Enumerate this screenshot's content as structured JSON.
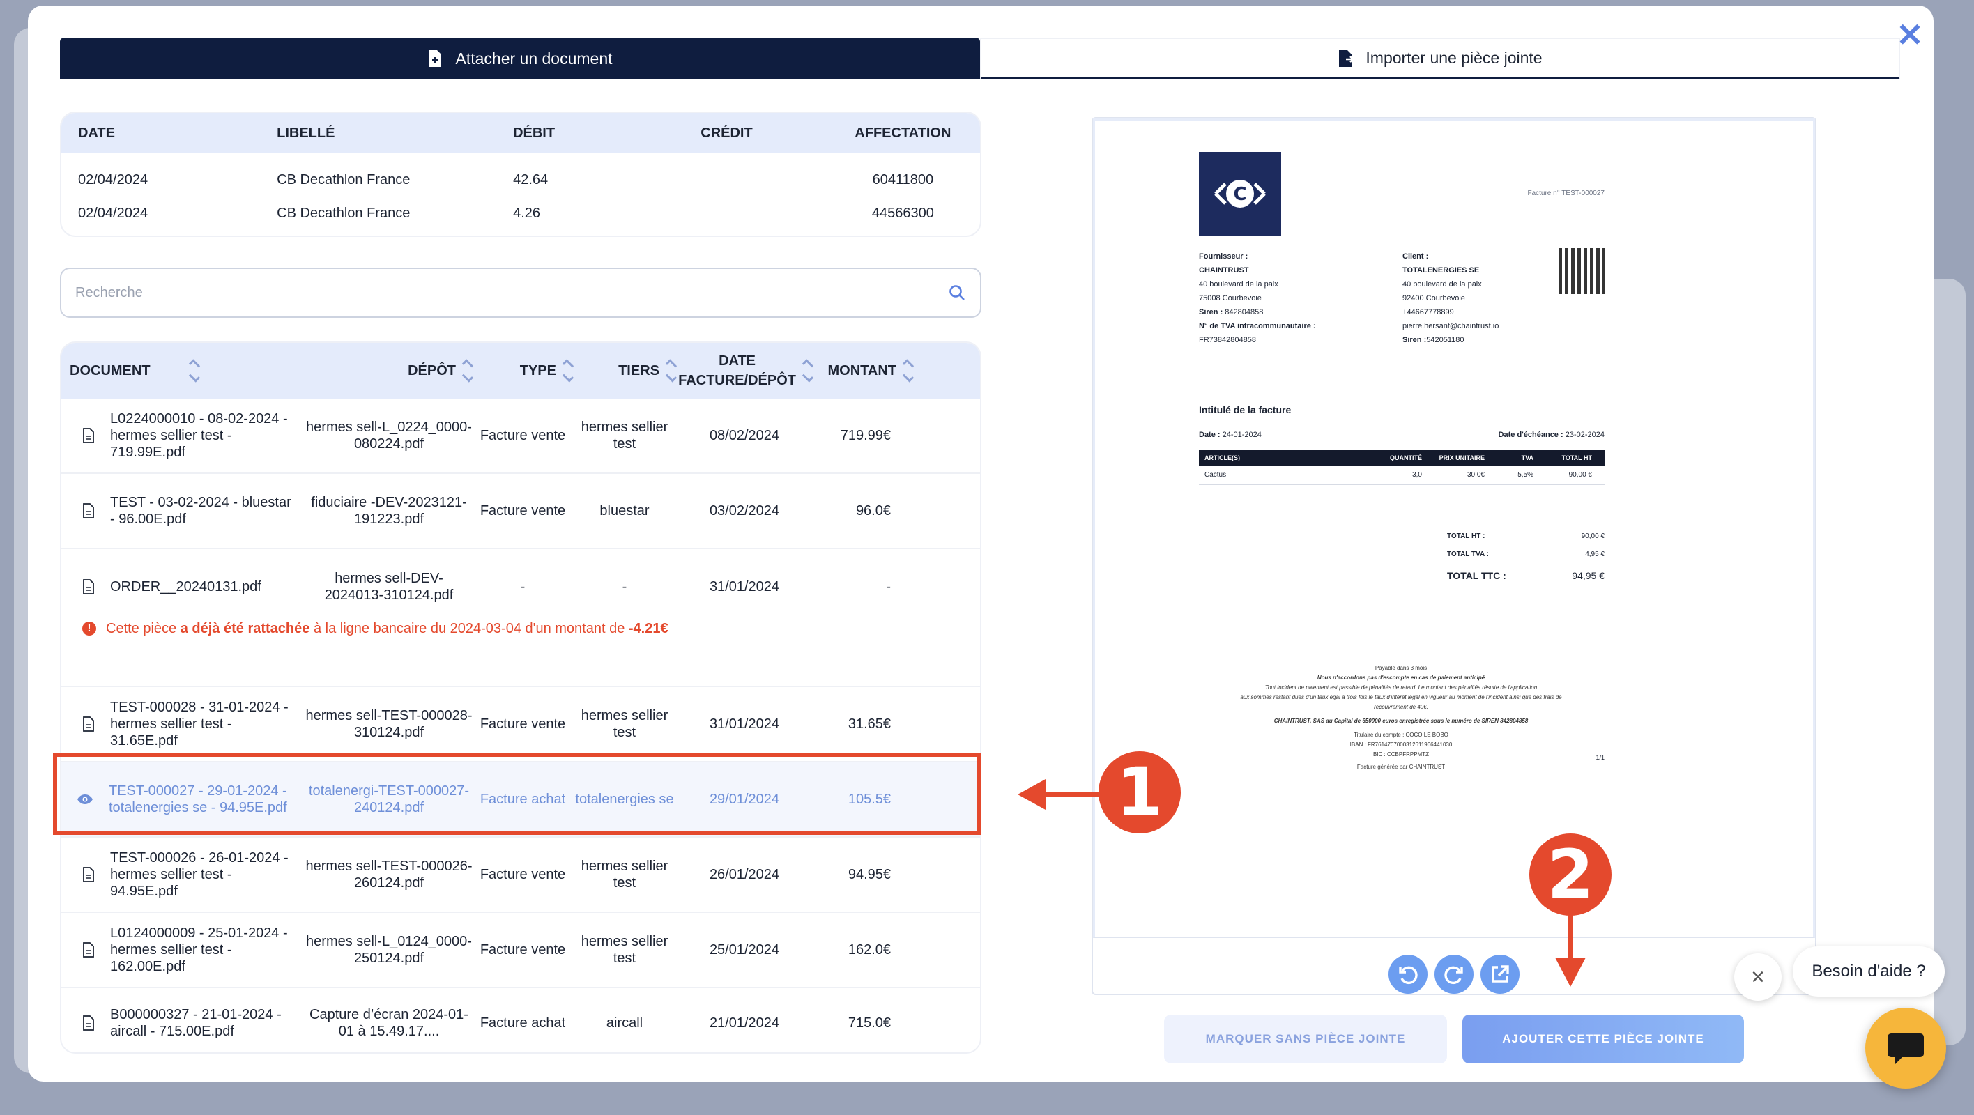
{
  "tabs": [
    {
      "label": "Attacher un document",
      "active": true
    },
    {
      "label": "Importer une pièce jointe",
      "active": false
    }
  ],
  "bank_table": {
    "headers": [
      "DATE",
      "LIBELLÉ",
      "DÉBIT",
      "CRÉDIT",
      "AFFECTATION"
    ],
    "rows": [
      {
        "date": "02/04/2024",
        "libelle": "CB Decathlon France",
        "debit": "42.64",
        "credit": "",
        "affectation": "60411800"
      },
      {
        "date": "02/04/2024",
        "libelle": "CB Decathlon France",
        "debit": "4.26",
        "credit": "",
        "affectation": "44566300"
      }
    ]
  },
  "search": {
    "placeholder": "Recherche",
    "value": ""
  },
  "docs_table": {
    "headers": {
      "document": "DOCUMENT",
      "depot": "DÉPÔT",
      "type": "TYPE",
      "tiers": "TIERS",
      "date_line1": "DATE",
      "date_line2": "FACTURE/DÉPÔT",
      "montant": "MONTANT"
    },
    "rows": [
      {
        "document": "L0224000010 - 08-02-2024 - hermes sellier test - 719.99E.pdf",
        "depot": "hermes sell-L_0224_0000-080224.pdf",
        "type": "Facture vente",
        "tiers": "hermes sellier test",
        "date": "08/02/2024",
        "montant": "719.99€"
      },
      {
        "document": "TEST - 03-02-2024 - bluestar - 96.00E.pdf",
        "depot": "fiduciaire -DEV-2023121-191223.pdf",
        "type": "Facture vente",
        "tiers": "bluestar",
        "date": "03/02/2024",
        "montant": "96.0€"
      },
      {
        "document": "ORDER__20240131.pdf",
        "depot": "hermes sell-DEV-2024013-310124.pdf",
        "type": "-",
        "tiers": "-",
        "date": "31/01/2024",
        "montant": "-"
      },
      {
        "document": "TEST-000028 - 31-01-2024 - hermes sellier test - 31.65E.pdf",
        "depot": "hermes sell-TEST-000028-310124.pdf",
        "type": "Facture vente",
        "tiers": "hermes sellier test",
        "date": "31/01/2024",
        "montant": "31.65€"
      },
      {
        "document": "TEST-000027 - 29-01-2024 - totalenergies se - 94.95E.pdf",
        "depot": "totalenergi-TEST-000027-240124.pdf",
        "type": "Facture achat",
        "tiers": "totalenergies se",
        "date": "29/01/2024",
        "montant": "105.5€"
      },
      {
        "document": "TEST-000026 - 26-01-2024 - hermes sellier test - 94.95E.pdf",
        "depot": "hermes sell-TEST-000026-260124.pdf",
        "type": "Facture vente",
        "tiers": "hermes sellier test",
        "date": "26/01/2024",
        "montant": "94.95€"
      },
      {
        "document": "L0124000009 - 25-01-2024 - hermes sellier test - 162.00E.pdf",
        "depot": "hermes sell-L_0124_0000-250124.pdf",
        "type": "Facture vente",
        "tiers": "hermes sellier test",
        "date": "25/01/2024",
        "montant": "162.0€"
      },
      {
        "document": "B000000327 - 21-01-2024 - aircall - 715.00E.pdf",
        "depot": "Capture d’écran 2024-01-01 à 15.49.17....",
        "type": "Facture achat",
        "tiers": "aircall",
        "date": "21/01/2024",
        "montant": "715.0€"
      }
    ],
    "warning": {
      "prefix": "Cette pièce ",
      "bold1": "a déjà été rattachée",
      "middle": " à la ligne bancaire du 2024-03-04 d'un montant de ",
      "bold2": "-4.21€"
    }
  },
  "invoice": {
    "logo_letter": "C",
    "ref": "Facture n° TEST-000027",
    "supplier": {
      "label": "Fournisseur :",
      "name": "CHAINTRUST",
      "address1": "40 boulevard de la paix",
      "address2": "75008 Courbevoie",
      "siren_label": "Siren :",
      "siren": "842804858",
      "tva_label": "N° de TVA intracommunautaire :",
      "tva": "FR73842804858"
    },
    "client": {
      "label": "Client :",
      "name": "TOTALENERGIES SE",
      "address1": "40 boulevard de la paix",
      "address2": "92400 Courbevoie",
      "phone": "+44667778899",
      "email": "pierre.hersant@chaintrust.io",
      "siren_label": "Siren :",
      "siren": "542051180"
    },
    "title": "Intitulé de la facture",
    "date_label": "Date :",
    "date": "24-01-2024",
    "due_label": "Date d'échéance :",
    "due": "23-02-2024",
    "table_headers": [
      "ARTICLE(S)",
      "QUANTITÉ",
      "PRIX UNITAIRE",
      "TVA",
      "TOTAL HT"
    ],
    "items": [
      {
        "article": "Cactus",
        "qty": "3,0",
        "unit": "30,0€",
        "tva": "5,5%",
        "total": "90,00 €"
      }
    ],
    "totals": [
      {
        "label": "TOTAL HT :",
        "value": "90,00 €"
      },
      {
        "label": "TOTAL TVA :",
        "value": "4,95 €"
      },
      {
        "label": "TOTAL TTC :",
        "value": "94,95 €"
      }
    ],
    "footer": [
      "Payable dans 3 mois",
      "Nous n'accordons pas d'escompte en cas de paiement anticipé",
      "Tout incident de paiement est passible de pénalités de retard. Le montant des pénalités résulte de l'application",
      "aux sommes restant dues d'un taux égal à trois fois le taux d'intérêt légal en vigueur au moment de l'incident ainsi que des frais de",
      "recouvrement de 40€.",
      "CHAINTRUST, SAS au Capital de 650000 euros enregistrée sous le numéro de SIREN 842804858",
      "Titulaire du compte : COCO LE BOBO",
      "IBAN : FR7614707000312611966441030",
      "BIC : CCBPFRPPMTZ",
      "Facture générée par CHAINTRUST"
    ],
    "page": "1/1"
  },
  "buttons": {
    "mark_without": "MARQUER SANS PIÈCE JOINTE",
    "add_attachment": "AJOUTER CETTE PIÈCE JOINTE"
  },
  "annotations": {
    "step1": "1",
    "step2": "2"
  },
  "help": {
    "label": "Besoin d'aide ?"
  },
  "colors": {
    "navy": "#0f1d3f",
    "accent": "#6c9df0",
    "annotation": "#e4492d",
    "chat": "#f6b63b"
  }
}
